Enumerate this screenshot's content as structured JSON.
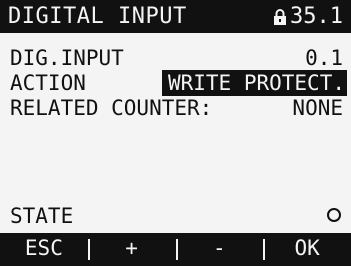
{
  "header": {
    "title": "DIGITAL INPUT",
    "lock_icon": "lock-icon",
    "menu_code": "35.1"
  },
  "fields": {
    "dig_input_label": "DIG.INPUT",
    "dig_input_value": "0.1",
    "action_label": "ACTION",
    "action_value": "WRITE PROTECT.",
    "related_counter_label": "RELATED COUNTER:",
    "related_counter_value": "NONE",
    "state_label": "STATE",
    "state_indicator_icon": "circle-off-icon"
  },
  "softkeys": {
    "esc": "ESC",
    "plus": "+",
    "minus": "-",
    "ok": "OK"
  },
  "colors": {
    "background": "#f4f4f4",
    "foreground": "#111111"
  }
}
